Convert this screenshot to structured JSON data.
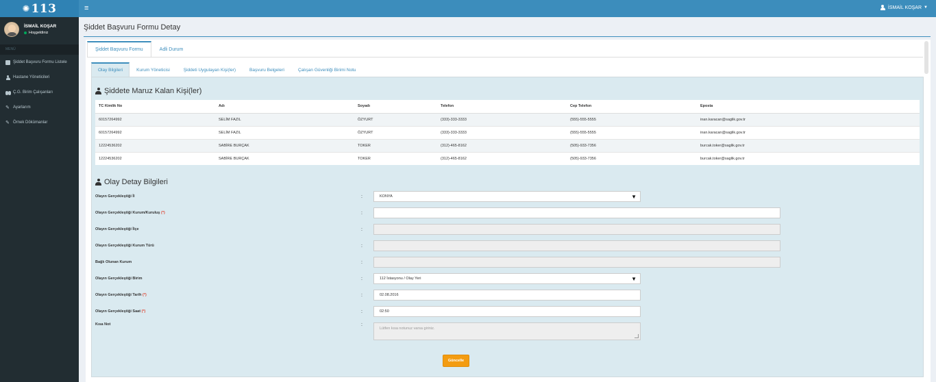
{
  "header": {
    "logo_text": "113",
    "menu_toggle": "≡",
    "user_name": "İSMAİL KOŞAR"
  },
  "sidebar": {
    "user_name": "İSMAİL KOŞAR",
    "user_status": "Hoşgeldiniz",
    "menu_header": "MENÜ",
    "items": [
      {
        "label": "Şiddet Başvuru Formu Listele",
        "icon": "book-icon"
      },
      {
        "label": "Hastane Yöneticileri",
        "icon": "user-icon"
      },
      {
        "label": "Ç.G. Birim Çalışanları",
        "icon": "users-icon"
      },
      {
        "label": "Ayarlarım",
        "icon": "wrench-icon"
      },
      {
        "label": "Örnek Dökümanlar",
        "icon": "wrench-icon"
      }
    ]
  },
  "page": {
    "title": "Şiddet Başvuru Formu Detay",
    "tabs": [
      {
        "label": "Şiddet Başvuru Formu",
        "active": true
      },
      {
        "label": "Adli Durum",
        "active": false
      }
    ],
    "subtabs": [
      {
        "label": "Olay Bilgileri",
        "active": true
      },
      {
        "label": "Kurum Yöneticisi",
        "active": false
      },
      {
        "label": "Şiddeti Uygulayan Kişi(ler)",
        "active": false
      },
      {
        "label": "Başvuru Belgeleri",
        "active": false
      },
      {
        "label": "Çalışan Güvenliği Birimi Notu",
        "active": false
      }
    ]
  },
  "victims": {
    "title": "Şiddete Maruz Kalan Kişi(ler)",
    "columns": [
      "TC Kimlik No",
      "Adı",
      "Soyadı",
      "Telefon",
      "Cep Telefon",
      "Eposta"
    ],
    "rows": [
      [
        "60157264992",
        "SELİM FAZIL",
        "ÖZYURT",
        "(333)-333-3333",
        "(555)-555-5555",
        "inan.karacan@saglik.gov.tr"
      ],
      [
        "60157264992",
        "SELİM FAZIL",
        "ÖZYURT",
        "(333)-333-3333",
        "(555)-555-5555",
        "inan.karacan@saglik.gov.tr"
      ],
      [
        "12224536202",
        "SABİRE BURÇAK",
        "TOKER",
        "(312)-465-8162",
        "(505)-933-7356",
        "burcak.toker@saglik.gov.tr"
      ],
      [
        "12224536202",
        "SABİRE BURÇAK",
        "TOKER",
        "(312)-465-8162",
        "(505)-933-7356",
        "burcak.toker@saglik.gov.tr"
      ]
    ]
  },
  "details": {
    "title": "Olay Detay Bilgileri",
    "fields": [
      {
        "label": "Olayın Gerçekleştiği İl",
        "required": false,
        "value": "KONYA"
      },
      {
        "label": "Olayın Gerçekleştiği Kurum/Kuruluş",
        "required": true,
        "value": ""
      },
      {
        "label": "Olayın Gerçekleştiği İlçe",
        "required": false,
        "value": ""
      },
      {
        "label": "Olayın Gerçekleştiği Kurum Türü",
        "required": false,
        "value": ""
      },
      {
        "label": "Bağlı Olunan Kurum",
        "required": false,
        "value": ""
      },
      {
        "label": "Olayın Gerçekleştiği Birim",
        "required": false,
        "value": "112 İstasyonu / Olay Yeri"
      },
      {
        "label": "Olayın Gerçekleştiği Tarih",
        "required": true,
        "value": "02.08.2016"
      },
      {
        "label": "Olayın Gerçekleştiği Saat",
        "required": true,
        "value": "02:50"
      },
      {
        "label": "Kısa Not",
        "required": false,
        "value": "",
        "placeholder": "Lütfen kısa notunuz varsa giriniz."
      }
    ],
    "required_mark": "(*)",
    "colon": ":",
    "submit_label": "Güncelle"
  },
  "colors": {
    "brand": "#3c8dbc",
    "sidebar": "#222d32",
    "panel": "#daeaf0",
    "button": "#f39c12"
  }
}
